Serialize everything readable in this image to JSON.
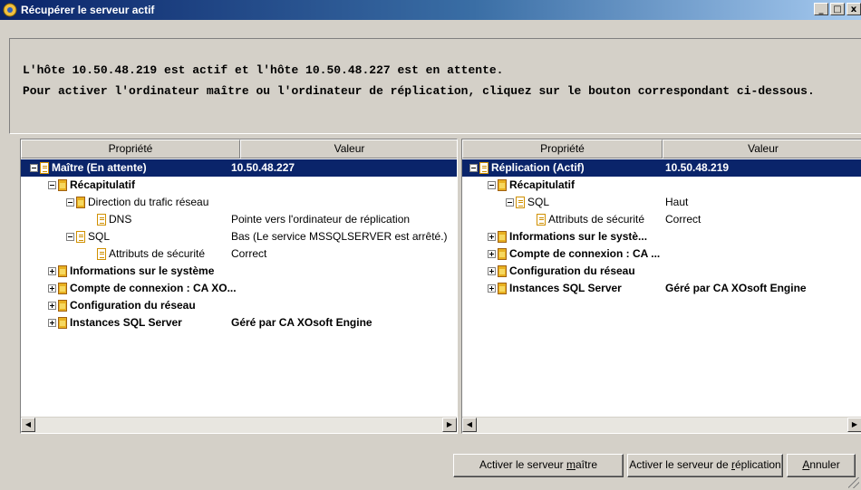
{
  "window": {
    "title": "Récupérer le serveur actif",
    "minimize": "_",
    "maximize": "□",
    "close": "x"
  },
  "message": {
    "line1": "L'hôte 10.50.48.219 est actif et l'hôte 10.50.48.227 est en attente.",
    "line2": "Pour activer l'ordinateur maître ou l'ordinateur de réplication, cliquez sur le bouton correspondant ci-dessous."
  },
  "left_panel": {
    "col_property": "Propriété",
    "col_value": "Valeur",
    "rows": [
      {
        "label": "Maître (En attente)",
        "value": "10.50.48.227"
      },
      {
        "label": "Récapitulatif",
        "value": ""
      },
      {
        "label": "Direction du trafic réseau",
        "value": ""
      },
      {
        "label": "DNS",
        "value": "Pointe vers l'ordinateur de réplication"
      },
      {
        "label": "SQL",
        "value": "Bas (Le service MSSQLSERVER est arrêté.)"
      },
      {
        "label": "Attributs de sécurité",
        "value": "Correct"
      },
      {
        "label": "Informations sur le système",
        "value": ""
      },
      {
        "label": "Compte de connexion : CA XO...",
        "value": ""
      },
      {
        "label": "Configuration du réseau",
        "value": ""
      },
      {
        "label": "Instances SQL Server",
        "value": "Géré par CA XOsoft Engine"
      }
    ]
  },
  "right_panel": {
    "col_property": "Propriété",
    "col_value": "Valeur",
    "rows": [
      {
        "label": "Réplication (Actif)",
        "value": "10.50.48.219"
      },
      {
        "label": "Récapitulatif",
        "value": ""
      },
      {
        "label": "SQL",
        "value": "Haut"
      },
      {
        "label": "Attributs de sécurité",
        "value": "Correct"
      },
      {
        "label": "Informations sur le systè...",
        "value": ""
      },
      {
        "label": "Compte de connexion : CA ...",
        "value": ""
      },
      {
        "label": "Configuration du réseau",
        "value": ""
      },
      {
        "label": "Instances SQL Server",
        "value": "Géré par CA XOsoft Engine"
      }
    ]
  },
  "scrollbar": {
    "left_arrow": "◀",
    "right_arrow": "▶"
  },
  "buttons": {
    "activate_master_pre": "Activer le serveur ",
    "activate_master_u": "m",
    "activate_master_post": "aître",
    "activate_replica_pre": "Activer le serveur de ",
    "activate_replica_u": "r",
    "activate_replica_post": "éplication",
    "cancel_u": "A",
    "cancel_post": "nnuler"
  },
  "colors": {
    "selection": "#0a246a",
    "titlebar": "#0a246a",
    "face": "#d4d0c8"
  }
}
